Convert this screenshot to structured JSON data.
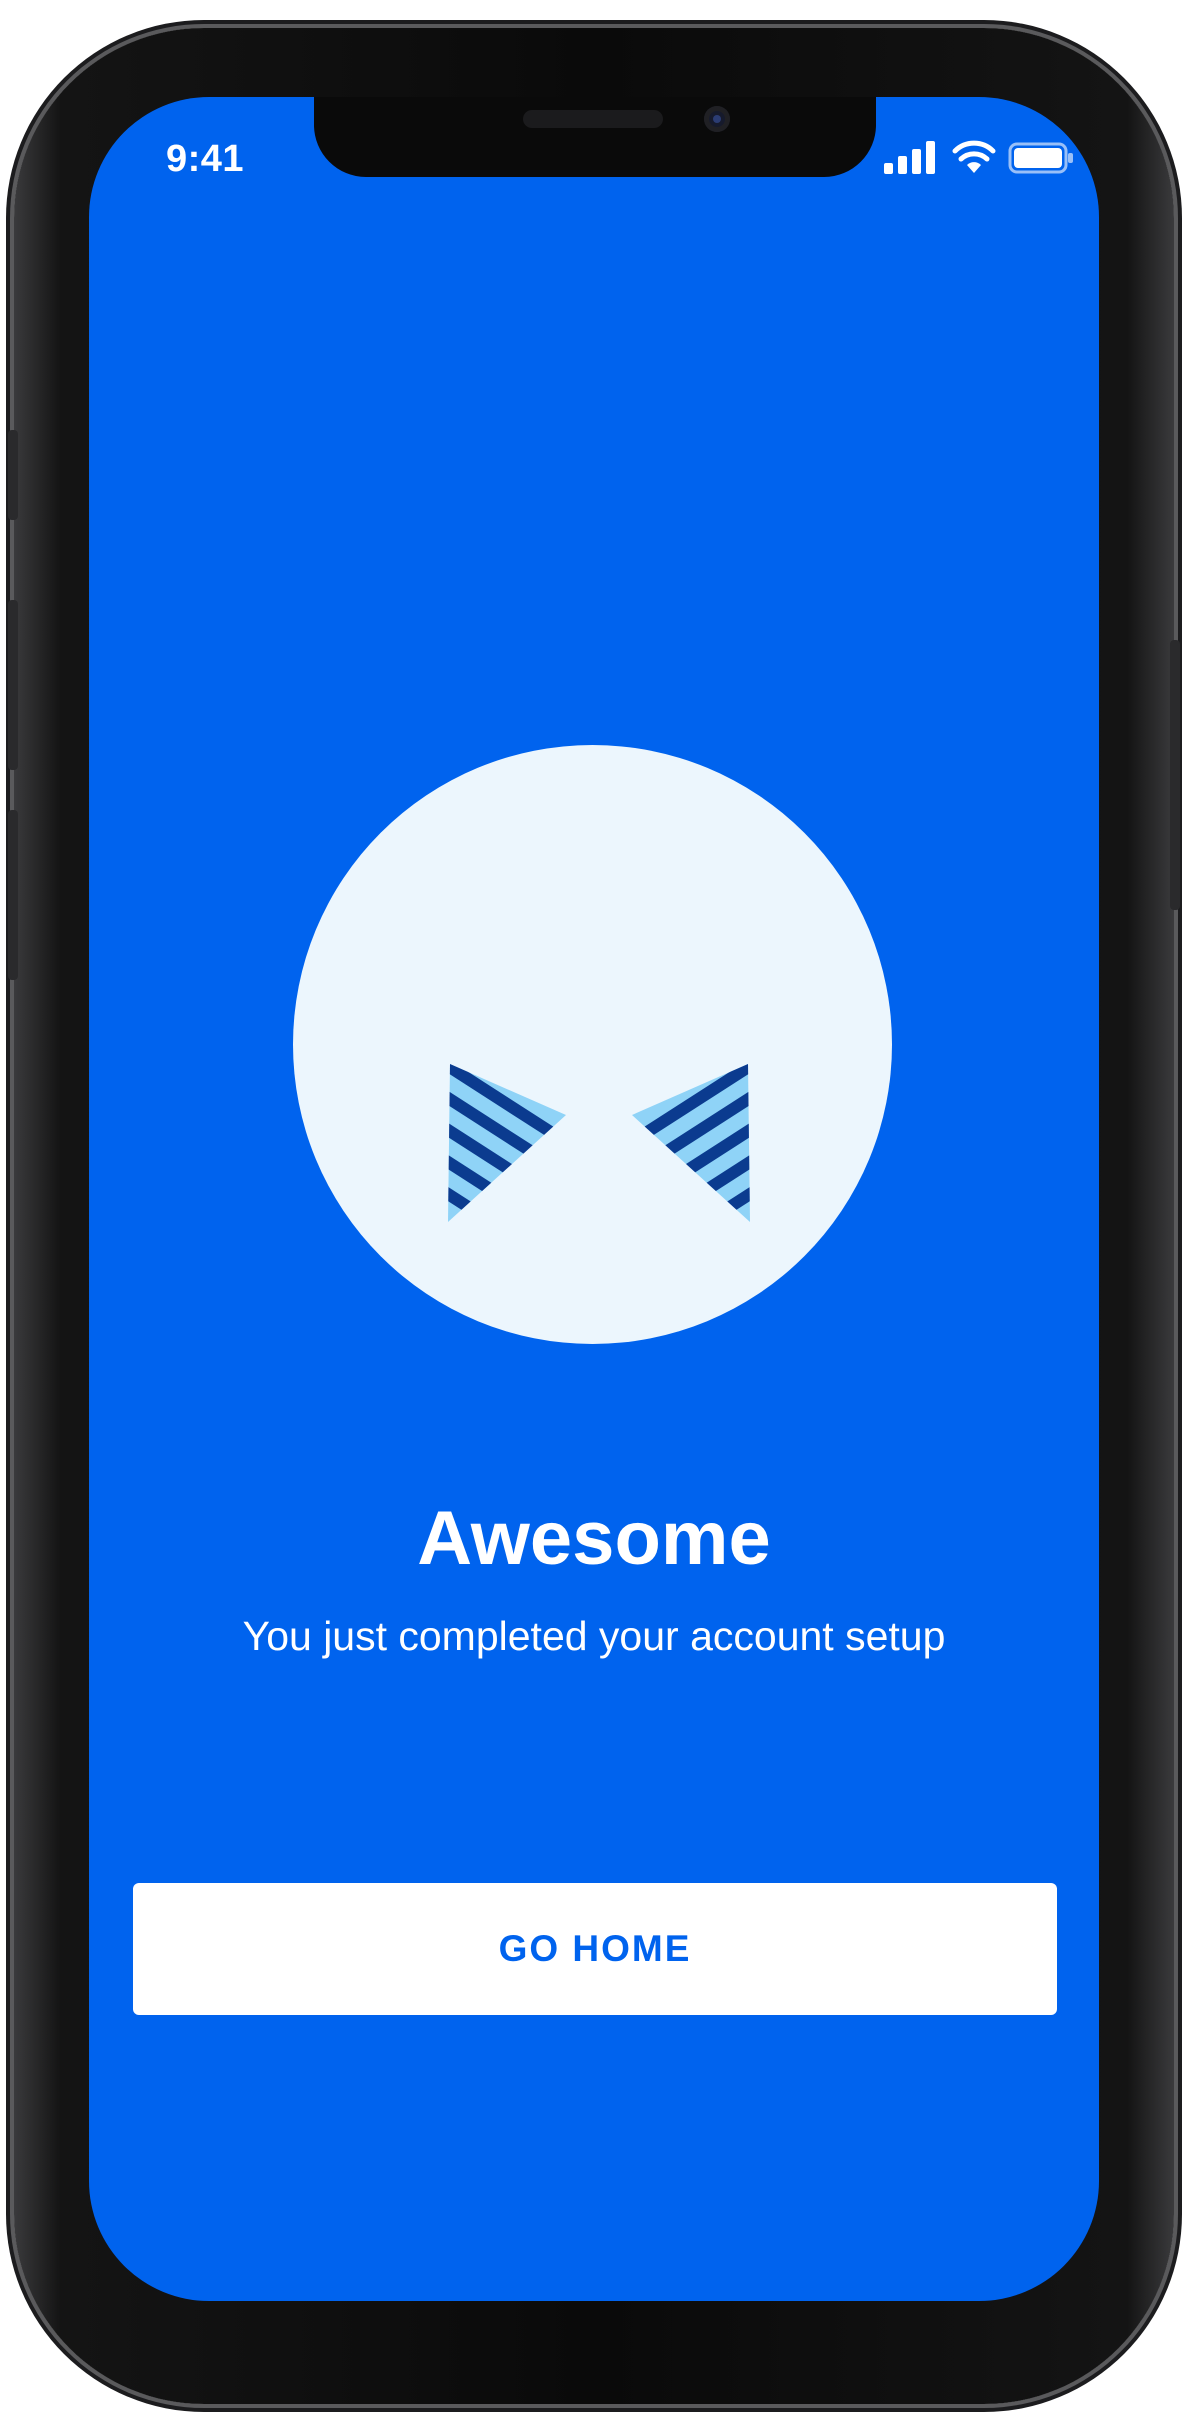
{
  "colors": {
    "accent": "#0063ee",
    "hero_circle": "#ecf6fd",
    "stripe_light": "#8fd3f7",
    "stripe_dark": "#0b3b8f"
  },
  "status_bar": {
    "time": "9:41",
    "icons": [
      "signal-bars-icon",
      "wifi-icon",
      "battery-icon"
    ]
  },
  "main": {
    "illustration": "bowtie-icon",
    "title": "Awesome",
    "subtitle": "You just completed your account setup",
    "primary_button_label": "GO HOME"
  }
}
